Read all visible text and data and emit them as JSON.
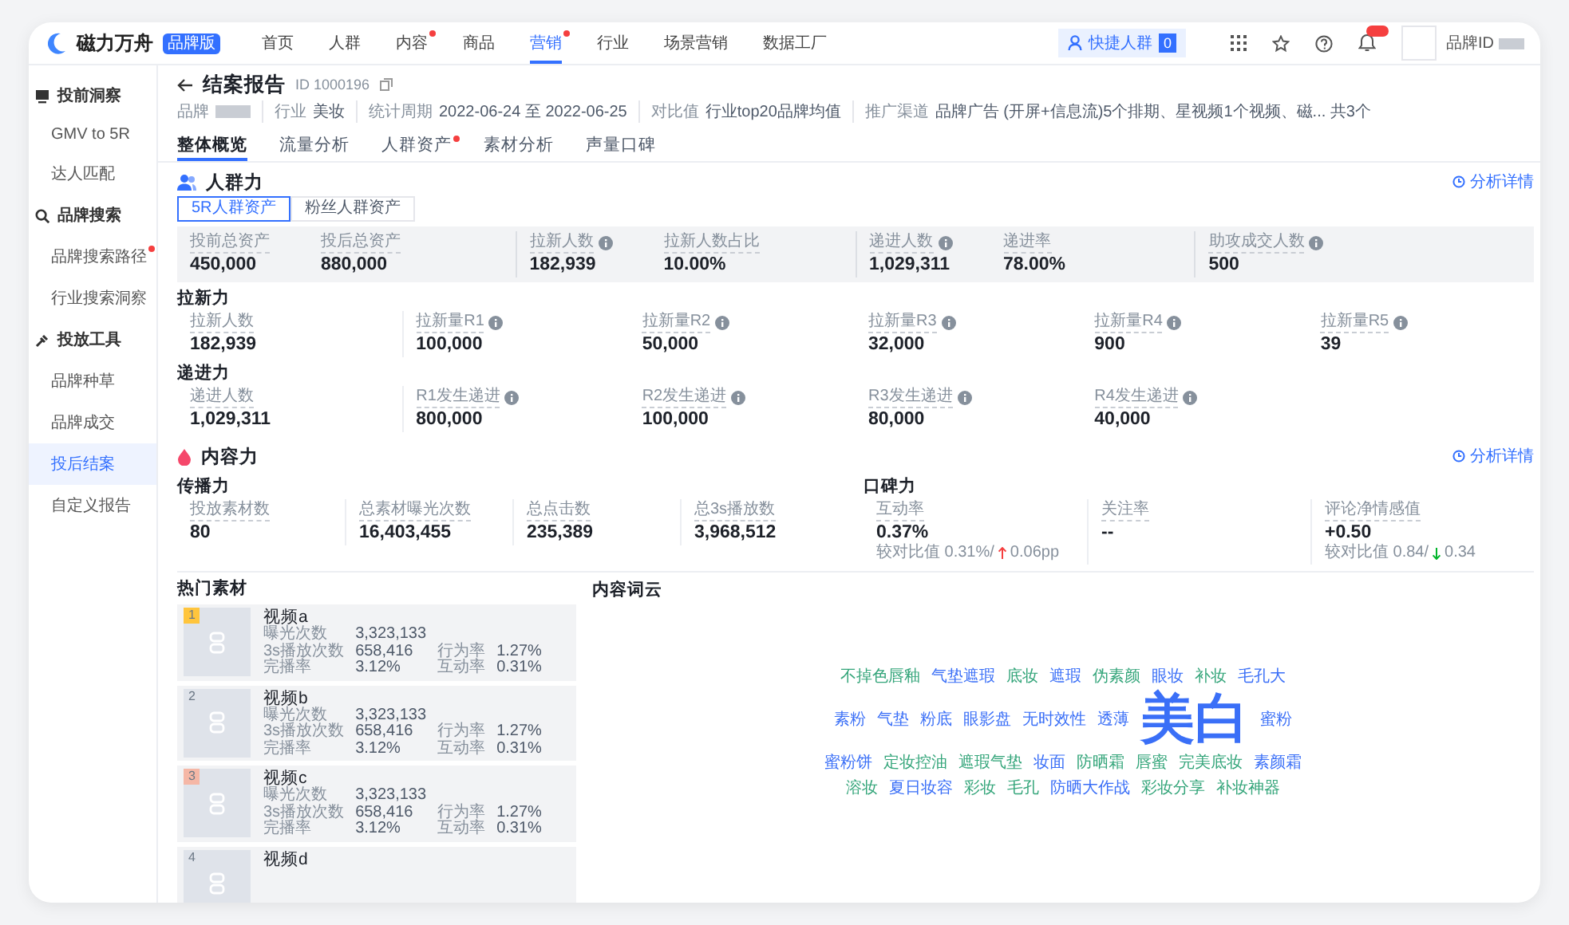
{
  "nav": {
    "logo": "磁力万舟",
    "edition": "品牌版",
    "items": [
      {
        "label": "首页",
        "selected": false,
        "dot": false
      },
      {
        "label": "人群",
        "selected": false,
        "dot": false
      },
      {
        "label": "内容",
        "selected": false,
        "dot": true
      },
      {
        "label": "商品",
        "selected": false,
        "dot": false
      },
      {
        "label": "营销",
        "selected": true,
        "dot": true
      },
      {
        "label": "行业",
        "selected": false,
        "dot": false
      },
      {
        "label": "场景营销",
        "selected": false,
        "dot": false
      },
      {
        "label": "数据工厂",
        "selected": false,
        "dot": false
      }
    ],
    "quick": {
      "label": "快捷人群",
      "count": "0"
    },
    "account": {
      "name": "品牌ID"
    }
  },
  "sidebar": {
    "groups": [
      {
        "title": "投前洞察",
        "items": [
          {
            "label": "GMV to 5R",
            "selected": false,
            "dot": false
          },
          {
            "label": "达人匹配",
            "selected": false,
            "dot": false
          }
        ]
      },
      {
        "title": "品牌搜索",
        "items": [
          {
            "label": "品牌搜索路径",
            "selected": false,
            "dot": true
          },
          {
            "label": "行业搜索洞察",
            "selected": false,
            "dot": false
          }
        ]
      },
      {
        "title": "投放工具",
        "items": [
          {
            "label": "品牌种草",
            "selected": false,
            "dot": false
          },
          {
            "label": "品牌成交",
            "selected": false,
            "dot": false
          },
          {
            "label": "投后结案",
            "selected": true,
            "dot": false
          },
          {
            "label": "自定义报告",
            "selected": false,
            "dot": false
          }
        ]
      }
    ]
  },
  "report": {
    "title": "结案报告",
    "id": "ID 1000196",
    "meta": [
      {
        "kind": "redacted",
        "label": "品牌"
      },
      {
        "kind": "text",
        "label": "行业",
        "value": "美妆"
      },
      {
        "kind": "text",
        "label": "统计周期",
        "value": "2022-06-24 至 2022-06-25"
      },
      {
        "kind": "text",
        "label": "对比值",
        "value": "行业top20品牌均值"
      },
      {
        "kind": "text",
        "label": "推广渠道",
        "value": "品牌广告 (开屏+信息流)5个排期、星视频1个视频、磁... 共3个"
      }
    ]
  },
  "tabs": [
    {
      "label": "整体概览",
      "selected": true,
      "dot": false
    },
    {
      "label": "流量分析",
      "selected": false,
      "dot": false
    },
    {
      "label": "人群资产",
      "selected": false,
      "dot": true
    },
    {
      "label": "素材分析",
      "selected": false,
      "dot": false
    },
    {
      "label": "声量口碑",
      "selected": false,
      "dot": false
    }
  ],
  "crowd": {
    "title": "人群力",
    "link": "分析详情",
    "subtabs": [
      {
        "label": "5R人群资产",
        "selected": true
      },
      {
        "label": "粉丝人群资产",
        "selected": false
      }
    ],
    "summary": [
      [
        {
          "label": "投前总资产",
          "value": "450,000"
        },
        {
          "label": "投后总资产",
          "value": "880,000"
        }
      ],
      [
        {
          "label": "拉新人数",
          "value": "182,939",
          "info": true
        },
        {
          "label": "拉新人数占比",
          "value": "10.00%"
        }
      ],
      [
        {
          "label": "递进人数",
          "value": "1,029,311",
          "info": true
        },
        {
          "label": "递进率",
          "value": "78.00%"
        }
      ],
      [
        {
          "label": "助攻成交人数",
          "value": "500",
          "info": true
        }
      ]
    ],
    "groups": [
      {
        "title": "拉新力",
        "stats": [
          {
            "label": "拉新人数",
            "value": "182,939"
          },
          {
            "label": "拉新量R1",
            "value": "100,000",
            "info": true
          },
          {
            "label": "拉新量R2",
            "value": "50,000",
            "info": true
          },
          {
            "label": "拉新量R3",
            "value": "32,000",
            "info": true
          },
          {
            "label": "拉新量R4",
            "value": "900",
            "info": true
          },
          {
            "label": "拉新量R5",
            "value": "39",
            "info": true
          }
        ]
      },
      {
        "title": "递进力",
        "stats": [
          {
            "label": "递进人数",
            "value": "1,029,311"
          },
          {
            "label": "R1发生递进",
            "value": "800,000",
            "info": true
          },
          {
            "label": "R2发生递进",
            "value": "100,000",
            "info": true
          },
          {
            "label": "R3发生递进",
            "value": "80,000",
            "info": true
          },
          {
            "label": "R4发生递进",
            "value": "40,000",
            "info": true
          }
        ]
      }
    ]
  },
  "content": {
    "title": "内容力",
    "link": "分析详情",
    "spread": {
      "title": "传播力",
      "stats": [
        {
          "label": "投放素材数",
          "value": "80"
        },
        {
          "label": "总素材曝光次数",
          "value": "16,403,455"
        },
        {
          "label": "总点击数",
          "value": "235,389"
        },
        {
          "label": "总3s播放数",
          "value": "3,968,512"
        }
      ]
    },
    "wom": {
      "title": "口碑力",
      "stats": [
        {
          "label": "互动率",
          "value": "0.37%",
          "compare": "较对比值 0.31%/",
          "rising": true,
          "delta": "0.06pp"
        },
        {
          "label": "关注率",
          "value": "--"
        },
        {
          "label": "评论净情感值",
          "value": "+0.50",
          "compare": "较对比值 0.84/",
          "rising": false,
          "delta": "0.34"
        }
      ]
    }
  },
  "hot": {
    "title": "热门素材",
    "items": [
      {
        "rank": "1",
        "color": "#ffc53d",
        "title": "视频a",
        "metrics": [
          {
            "label": "曝光次数",
            "value": "3,323,133"
          },
          {
            "label": "3s播放次数",
            "value": "658,416"
          },
          {
            "label": "行为率",
            "value": "1.27%"
          },
          {
            "label": "完播率",
            "value": "3.12%"
          },
          {
            "label": "互动率",
            "value": "0.31%"
          }
        ]
      },
      {
        "rank": "2",
        "color": "#dfe3ea",
        "title": "视频b",
        "metrics": [
          {
            "label": "曝光次数",
            "value": "3,323,133"
          },
          {
            "label": "3s播放次数",
            "value": "658,416"
          },
          {
            "label": "行为率",
            "value": "1.27%"
          },
          {
            "label": "完播率",
            "value": "3.12%"
          },
          {
            "label": "互动率",
            "value": "0.31%"
          }
        ]
      },
      {
        "rank": "3",
        "color": "#f5b7a6",
        "title": "视频c",
        "metrics": [
          {
            "label": "曝光次数",
            "value": "3,323,133"
          },
          {
            "label": "3s播放次数",
            "value": "658,416"
          },
          {
            "label": "行为率",
            "value": "1.27%"
          },
          {
            "label": "完播率",
            "value": "3.12%"
          },
          {
            "label": "互动率",
            "value": "0.31%"
          }
        ]
      },
      {
        "rank": "4",
        "color": "#dfe3ea",
        "title": "视频d"
      }
    ]
  },
  "cloud": {
    "title": "内容词云",
    "words": [
      {
        "text": "不掉色唇釉",
        "color": "#34a57a",
        "kind": "normal"
      },
      {
        "text": "气垫遮瑕",
        "color": "#3a6ff7",
        "kind": "normal"
      },
      {
        "text": "底妆",
        "color": "#34a57a",
        "kind": "normal"
      },
      {
        "text": "遮瑕",
        "color": "#3a6ff7",
        "kind": "normal"
      },
      {
        "text": "伪素颜",
        "color": "#34a57a",
        "kind": "normal"
      },
      {
        "text": "眼妆",
        "color": "#3a6ff7",
        "kind": "normal"
      },
      {
        "text": "补妆",
        "color": "#34a57a",
        "kind": "normal"
      },
      {
        "text": "毛孔大",
        "color": "#3a6ff7",
        "kind": "normal"
      },
      {
        "text": "素粉",
        "color": "#3a6ff7",
        "kind": "normal"
      },
      {
        "text": "气垫",
        "color": "#3a6ff7",
        "kind": "normal"
      },
      {
        "text": "粉底",
        "color": "#3a6ff7",
        "kind": "normal"
      },
      {
        "text": "眼影盘",
        "color": "#3a6ff7",
        "kind": "normal"
      },
      {
        "text": "无时效性",
        "color": "#3a6ff7",
        "kind": "normal"
      },
      {
        "text": "透薄",
        "color": "#3a6ff7",
        "kind": "normal"
      },
      {
        "text": "美白",
        "color": "#3a6ff7",
        "kind": "main"
      },
      {
        "text": "蜜粉",
        "color": "#3a6ff7",
        "kind": "normal"
      },
      {
        "text": "蜜粉饼",
        "color": "#3a6ff7",
        "kind": "normal"
      },
      {
        "text": "定妆控油",
        "color": "#34a57a",
        "kind": "normal"
      },
      {
        "text": "遮瑕气垫",
        "color": "#34a57a",
        "kind": "normal"
      },
      {
        "text": "妆面",
        "color": "#3a6ff7",
        "kind": "normal"
      },
      {
        "text": "防晒霜",
        "color": "#34a57a",
        "kind": "normal"
      },
      {
        "text": "唇蜜",
        "color": "#34a57a",
        "kind": "normal"
      },
      {
        "text": "完美底妆",
        "color": "#34a57a",
        "kind": "normal"
      },
      {
        "text": "素颜霜",
        "color": "#3a6ff7",
        "kind": "normal"
      },
      {
        "text": "溶妆",
        "color": "#34a57a",
        "kind": "normal"
      },
      {
        "text": "夏日妆容",
        "color": "#3a6ff7",
        "kind": "normal"
      },
      {
        "text": "彩妆",
        "color": "#34a57a",
        "kind": "normal"
      },
      {
        "text": "毛孔",
        "color": "#34a57a",
        "kind": "normal"
      },
      {
        "text": "防晒大作战",
        "color": "#3a6ff7",
        "kind": "normal"
      },
      {
        "text": "彩妆分享",
        "color": "#34a57a",
        "kind": "normal"
      },
      {
        "text": "补妆神器",
        "color": "#34a57a",
        "kind": "normal"
      }
    ]
  }
}
